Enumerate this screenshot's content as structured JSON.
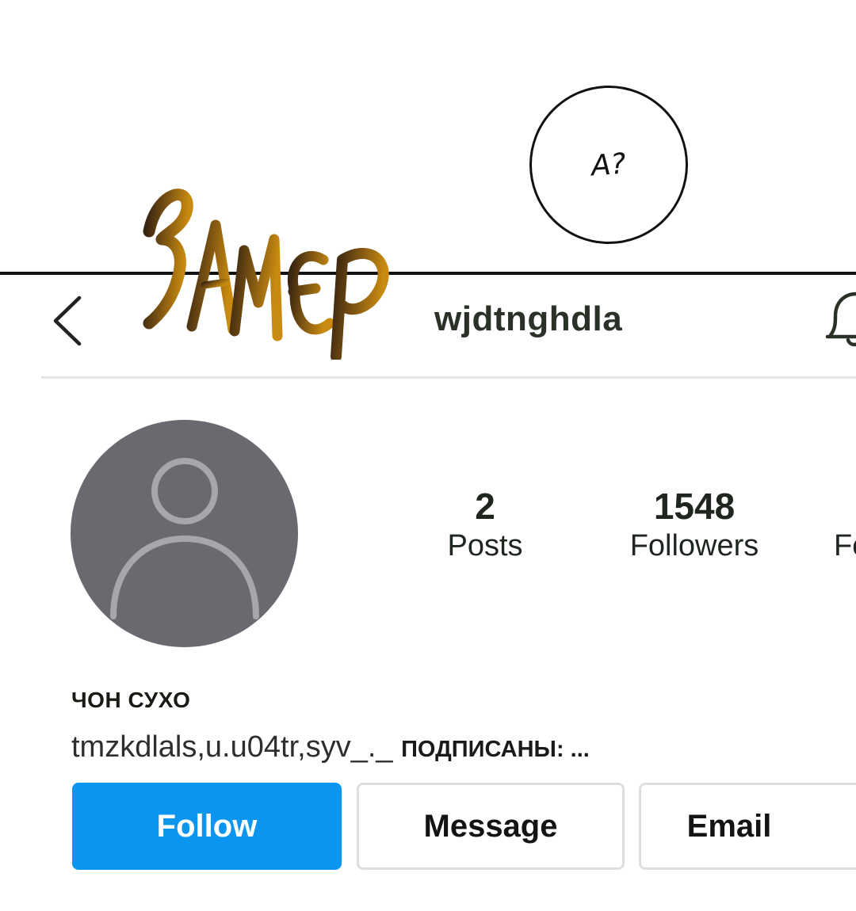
{
  "comic": {
    "speech_bubble": "А?",
    "sfx_text": "ЗАМЕР",
    "sfx_colors": [
      "#3a2510",
      "#7a5212",
      "#c88a10"
    ]
  },
  "header": {
    "username": "wjdtnghdla",
    "back_icon": "chevron-left-icon",
    "bell_icon": "bell-icon"
  },
  "profile": {
    "avatar_icon": "default-user-silhouette",
    "avatar_color": "#696a70",
    "stats": [
      {
        "count": "2",
        "label": "Posts"
      },
      {
        "count": "1548",
        "label": "Followers"
      },
      {
        "label": "Fo"
      }
    ],
    "display_name": "ЧОН СУХО",
    "followed_by_names": "tmzkdlals,u.u04tr,syv_._",
    "followed_by_suffix": "ПОДПИСАНЫ: ..."
  },
  "actions": {
    "follow": "Follow",
    "message": "Message",
    "email": "Email",
    "follow_color": "#0a95f1"
  }
}
